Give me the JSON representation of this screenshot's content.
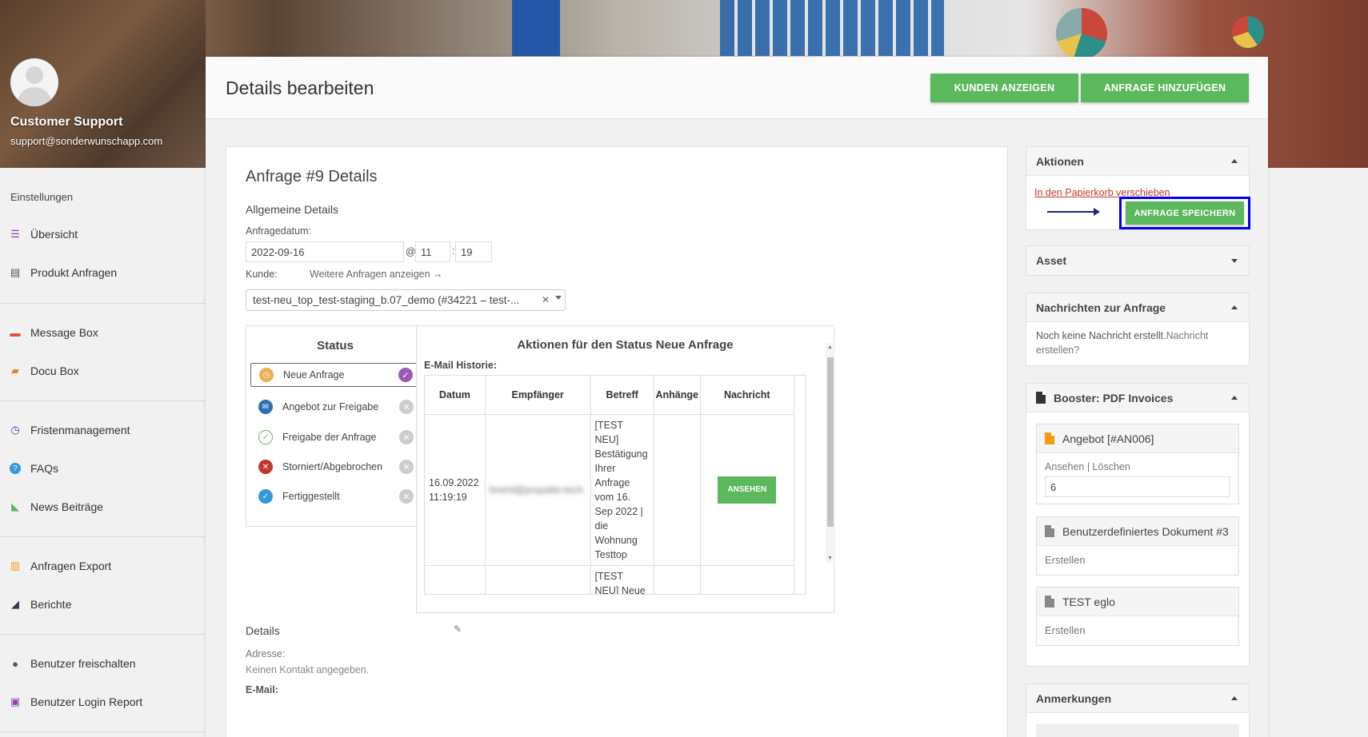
{
  "user": {
    "name": "Customer Support",
    "email": "support@sonderwunschapp.com"
  },
  "sidebar": {
    "heading": "Einstellungen",
    "items": [
      {
        "label": "Übersicht",
        "icon": "list-icon",
        "color": "#8e44ad"
      },
      {
        "label": "Produkt Anfragen",
        "icon": "table-icon",
        "color": "#555555"
      },
      {
        "label": "Message Box",
        "icon": "message-icon",
        "color": "#e74c3c"
      },
      {
        "label": "Docu Box",
        "icon": "folder-icon",
        "color": "#e67e22"
      },
      {
        "label": "Fristenmanagement",
        "icon": "clock-icon",
        "color": "#2c5aa0"
      },
      {
        "label": "FAQs",
        "icon": "help-icon",
        "color": "#3498db"
      },
      {
        "label": "News Beiträge",
        "icon": "rss-icon",
        "color": "#5cb85c"
      },
      {
        "label": "Anfragen Export",
        "icon": "export-icon",
        "color": "#f39c12"
      },
      {
        "label": "Berichte",
        "icon": "chart-icon",
        "color": "#2c3e50"
      },
      {
        "label": "Benutzer freischalten",
        "icon": "user-icon",
        "color": "#555555"
      },
      {
        "label": "Benutzer Login Report",
        "icon": "report-icon",
        "color": "#8e44ad"
      }
    ]
  },
  "header": {
    "title": "Details bearbeiten",
    "btn_customers": "KUNDEN ANZEIGEN",
    "btn_add_request": "ANFRAGE HINZUFÜGEN"
  },
  "details": {
    "title": "Anfrage #9 Details",
    "general": "Allgemeine Details",
    "date_label": "Anfragedatum:",
    "date": "2022-09-16",
    "at": "@",
    "hour": "11",
    "colon": ":",
    "minute": "19",
    "customer_label": "Kunde:",
    "more_requests": "Weitere Anfragen anzeigen →",
    "customer_value": "test-neu_top_test-staging_b.07_demo (#34221 – test-...",
    "details_label": "Details",
    "address_label": "Adresse:",
    "address_value": "Keinen Kontakt angegeben.",
    "email_label": "E-Mail:"
  },
  "status": {
    "title": "Status",
    "items": [
      {
        "label": "Neue Anfrage",
        "color": "#f0ad4e",
        "active": true
      },
      {
        "label": "Angebot zur Freigabe",
        "color": "#2c6fb0",
        "active": false
      },
      {
        "label": "Freigabe der Anfrage",
        "color": "#5cb85c",
        "active": false
      },
      {
        "label": "Storniert/Abgebrochen",
        "color": "#c0392b",
        "active": false
      },
      {
        "label": "Fertiggestellt",
        "color": "#3498db",
        "active": false
      }
    ]
  },
  "actions": {
    "title": "Aktionen für den Status Neue Anfrage",
    "email_history": "E-Mail Historie:",
    "columns": [
      "Datum",
      "Empfänger",
      "Betreff",
      "Anhänge",
      "Nachricht"
    ],
    "rows": [
      {
        "date": "16.09.2022 11:19:19",
        "recipient": "bnent@propater.tech",
        "subject": "[TEST NEU] Bestätigung Ihrer Anfrage vom 16. Sep 2022 | die Wohnung Testtop",
        "attachments": "",
        "button": "ANSEHEN"
      },
      {
        "date": "",
        "recipient": "",
        "subject": "[TEST NEU] Neue",
        "attachments": "",
        "button": ""
      }
    ]
  },
  "right": {
    "aktionen": {
      "title": "Aktionen",
      "trash_link": "In den Papierkorb verschieben",
      "save_btn": "ANFRAGE SPEICHERN"
    },
    "asset": {
      "title": "Asset"
    },
    "messages": {
      "title": "Nachrichten zur Anfrage",
      "text": "Noch keine Nachricht erstellt.",
      "link": "Nachricht erstellen?"
    },
    "booster": {
      "title": "Booster: PDF Invoices",
      "docs": [
        {
          "title": "Angebot [#AN006]",
          "actions": "Ansehen | Löschen",
          "value": "6",
          "icon_color": "#f39c12"
        },
        {
          "title": "Benutzerdefiniertes Dokument #3",
          "action": "Erstellen",
          "icon_color": "#888888"
        },
        {
          "title": "TEST eglo",
          "action": "Erstellen",
          "icon_color": "#888888"
        }
      ]
    },
    "notes": {
      "title": "Anmerkungen"
    }
  },
  "colors": {
    "accent_green": "#5cb85c",
    "highlight_blue": "#0000ee",
    "link_red": "#c0392b"
  }
}
